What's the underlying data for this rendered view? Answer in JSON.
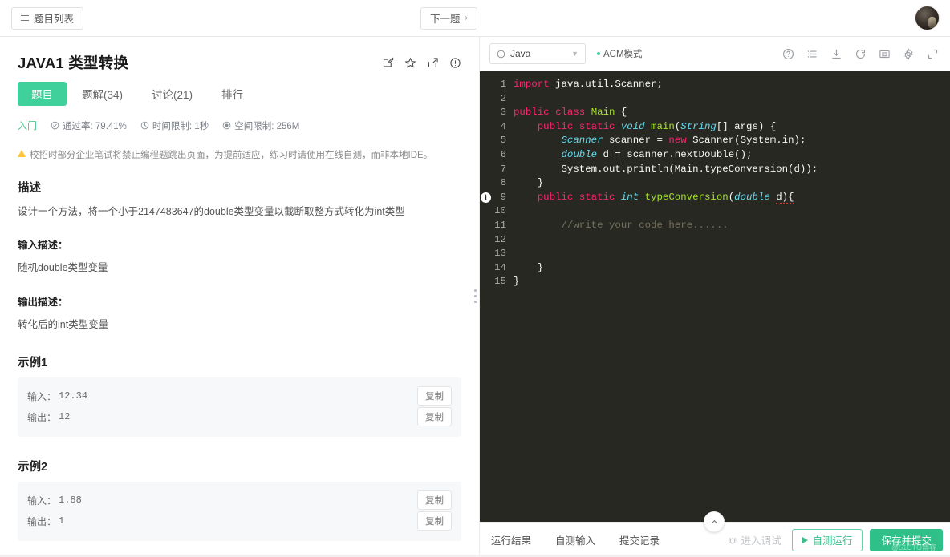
{
  "topbar": {
    "problem_list_label": "题目列表",
    "next_problem_label": "下一题",
    "next_chevron": "›",
    "list_icon": "list-icon",
    "avatar_icon": "user-avatar"
  },
  "problem": {
    "id": "JAVA1",
    "title": "类型转换",
    "full_title": "JAVA1  类型转换",
    "actions": [
      "edit-icon",
      "star-icon",
      "share-icon",
      "info-circle-icon"
    ],
    "tabs": [
      {
        "label": "题目",
        "active": true
      },
      {
        "label": "题解(34)",
        "active": false
      },
      {
        "label": "讨论(21)",
        "active": false
      },
      {
        "label": "排行",
        "active": false
      }
    ],
    "stats": {
      "level": "入门",
      "accept_rate": "通过率: 79.41%",
      "time_limit": "时间限制: 1秒",
      "space_limit": "空间限制: 256M"
    },
    "notice": "校招时部分企业笔试将禁止编程题跳出页面，为提前适应，练习时请使用在线自测，而非本地IDE。",
    "description_heading": "描述",
    "description_text": "设计一个方法，将一个小于2147483647的double类型变量以截断取整方式转化为int类型",
    "input_heading": "输入描述：",
    "input_text": "随机double类型变量",
    "output_heading": "输出描述：",
    "output_text": "转化后的int类型变量",
    "examples": [
      {
        "heading": "示例1",
        "input_label": "输入：",
        "input_value": "12.34",
        "output_label": "输出：",
        "output_value": "12",
        "copy_label": "复制"
      },
      {
        "heading": "示例2",
        "input_label": "输入：",
        "input_value": "1.88",
        "output_label": "输出：",
        "output_value": "1",
        "copy_label": "复制"
      }
    ]
  },
  "editor": {
    "language": "Java",
    "language_icon": "info-circle-icon",
    "mode_label": "ACM模式",
    "toolbar_icons": [
      "question-circle-icon",
      "list-icon",
      "download-icon",
      "reset-icon",
      "keyboard-icon",
      "gear-icon",
      "fullscreen-icon"
    ],
    "gutter_marker_line": 9,
    "gutter_marker_icon": "info-marker-icon",
    "code_lines": [
      {
        "n": 1,
        "text": "import java.util.Scanner;"
      },
      {
        "n": 2,
        "text": ""
      },
      {
        "n": 3,
        "text": "public class Main {"
      },
      {
        "n": 4,
        "text": "    public static void main(String[] args) {"
      },
      {
        "n": 5,
        "text": "        Scanner scanner = new Scanner(System.in);"
      },
      {
        "n": 6,
        "text": "        double d = scanner.nextDouble();"
      },
      {
        "n": 7,
        "text": "        System.out.println(Main.typeConversion(d));"
      },
      {
        "n": 8,
        "text": "    }"
      },
      {
        "n": 9,
        "text": "    public static int typeConversion(double d){"
      },
      {
        "n": 10,
        "text": ""
      },
      {
        "n": 11,
        "text": "        //write your code here......"
      },
      {
        "n": 12,
        "text": ""
      },
      {
        "n": 13,
        "text": ""
      },
      {
        "n": 14,
        "text": "    }"
      },
      {
        "n": 15,
        "text": "}"
      }
    ]
  },
  "footer": {
    "tabs": [
      "运行结果",
      "自测输入",
      "提交记录"
    ],
    "debug_label": "进入调试",
    "run_label": "自测运行",
    "submit_label": "保存并提交",
    "watermark": "@51CTO博客",
    "collapse_icon": "chevron-up-icon"
  },
  "colors": {
    "accent_green": "#3FD09B",
    "submit_green": "#2FC08A",
    "editor_bg": "#272822",
    "keyword": "#f92672",
    "type": "#66d9ef",
    "classname": "#a6e22e",
    "comment": "#75715e"
  }
}
